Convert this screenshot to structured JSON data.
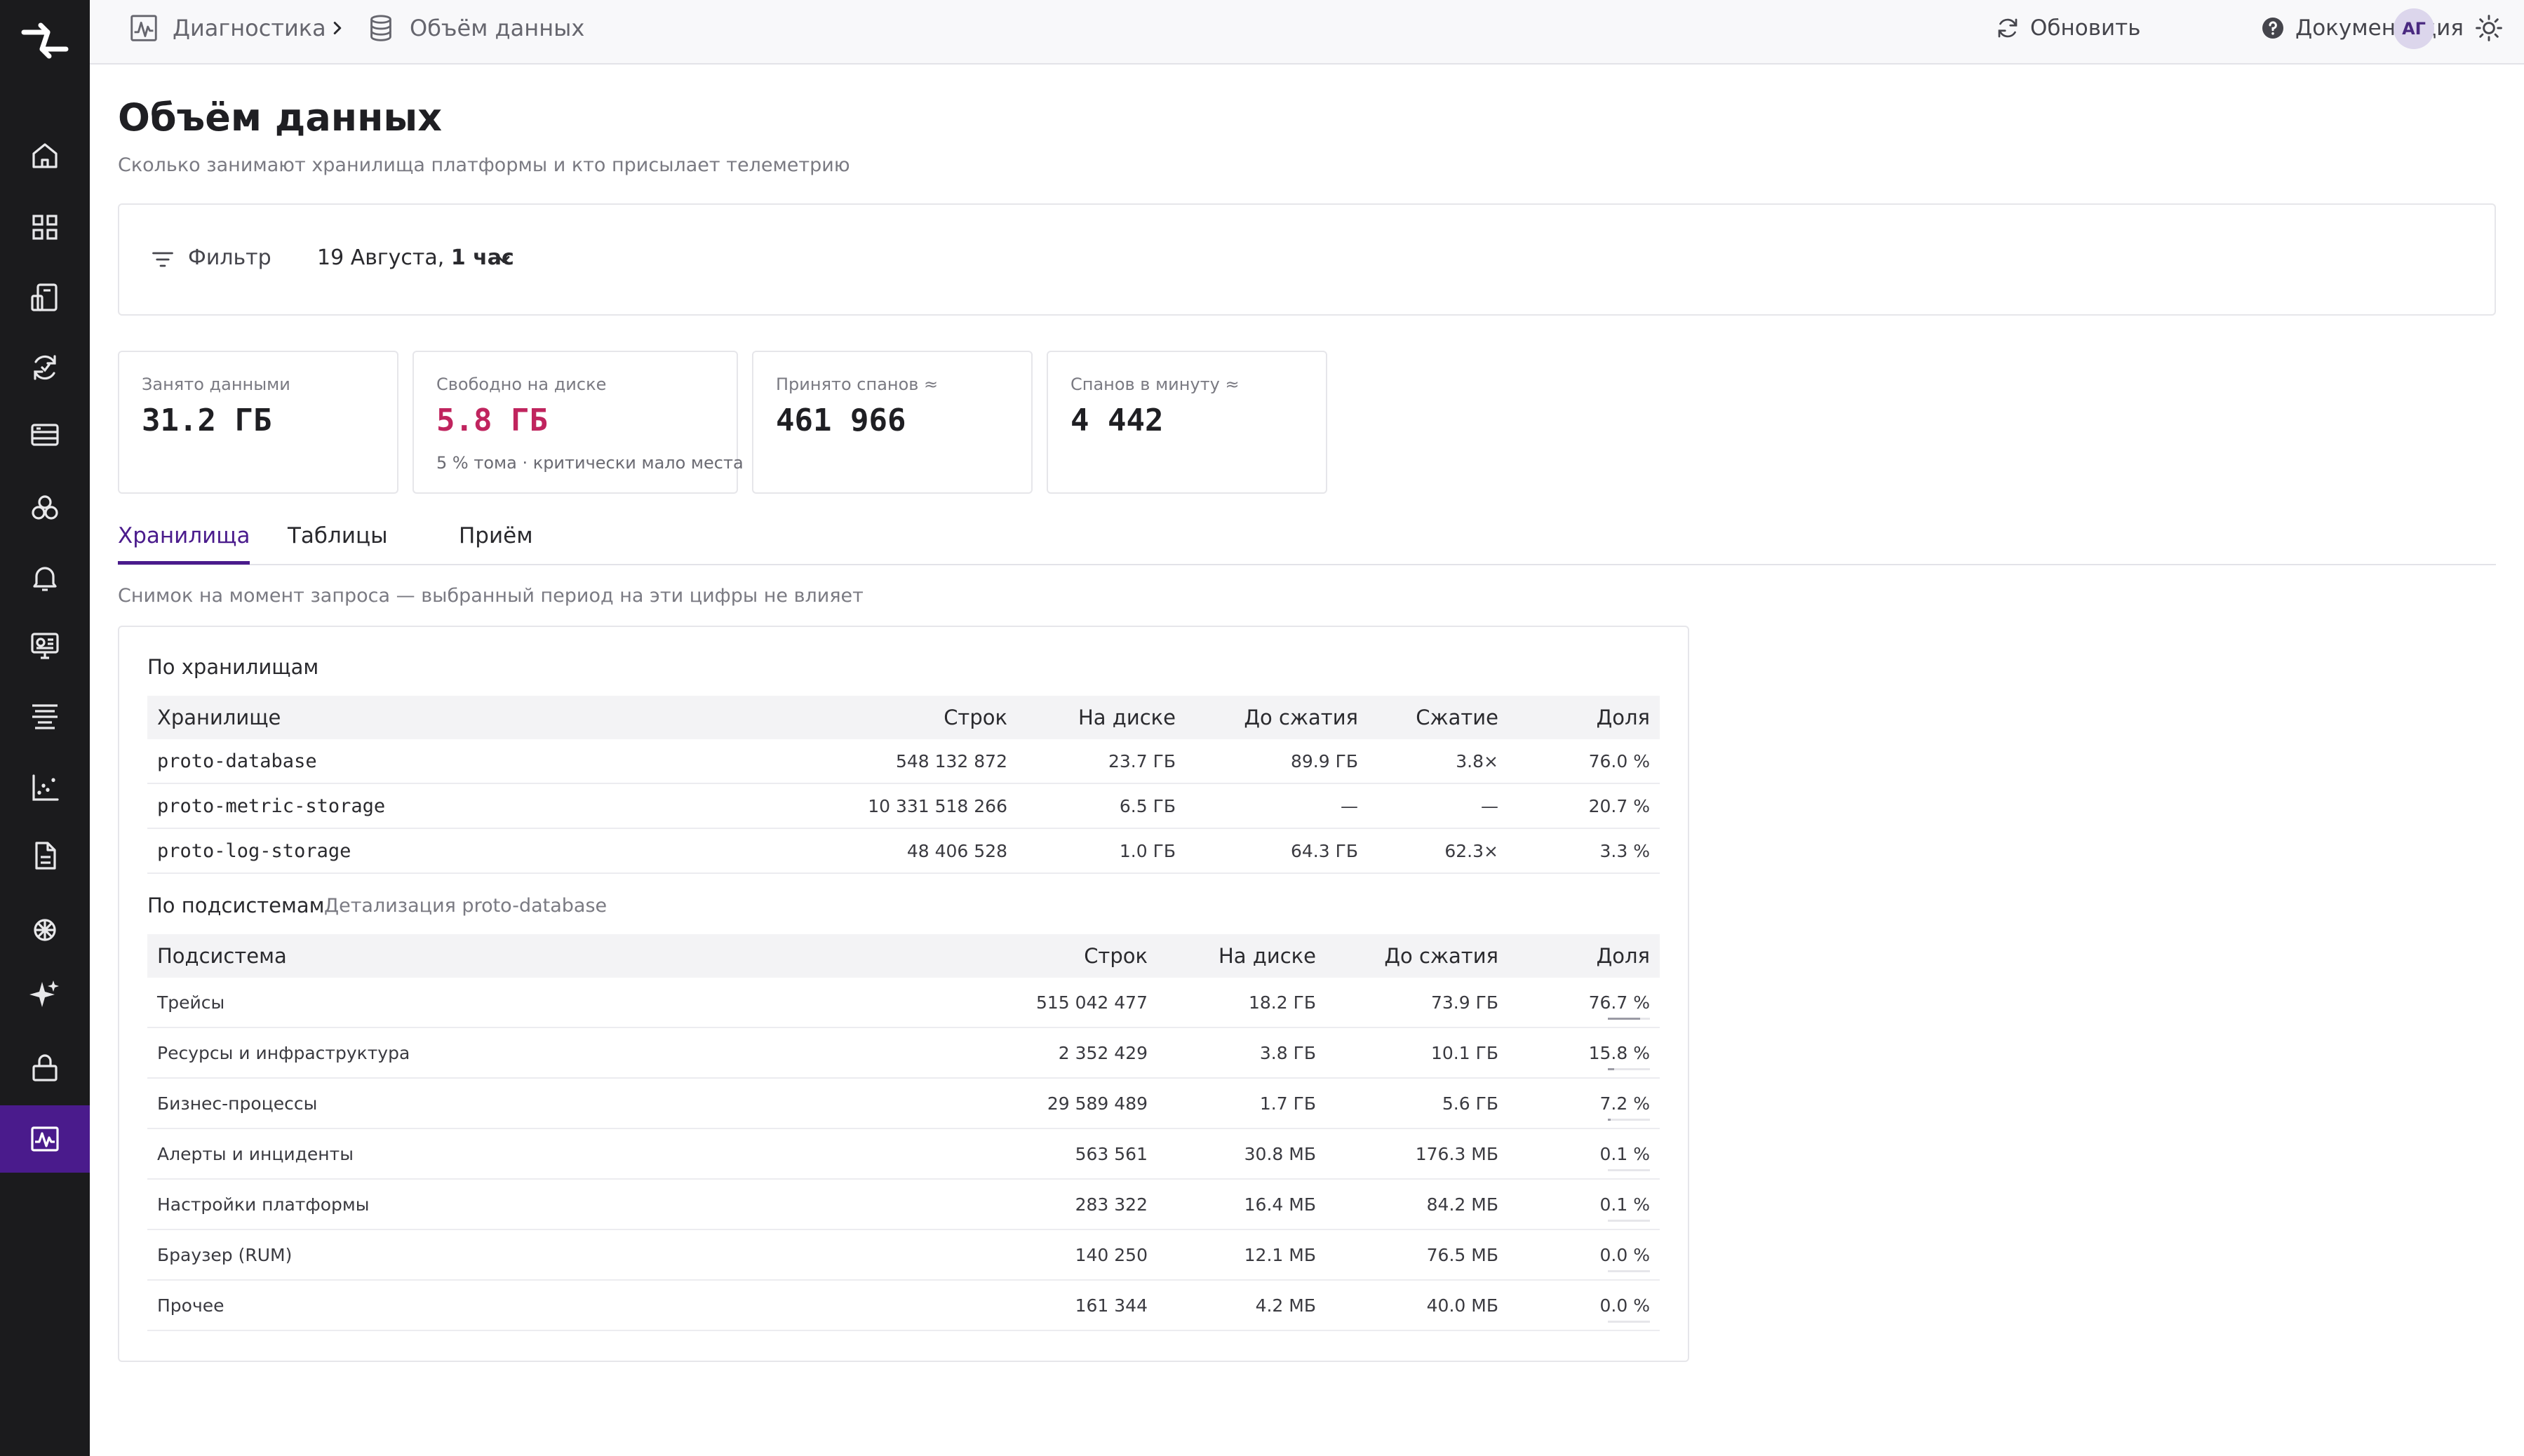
{
  "sidebar": {
    "items": [
      {
        "icon": "home-icon"
      },
      {
        "icon": "grid-icon"
      },
      {
        "icon": "device-icon"
      },
      {
        "icon": "sync-icon"
      },
      {
        "icon": "server-icon"
      },
      {
        "icon": "hexagons-icon"
      },
      {
        "icon": "bell-icon"
      },
      {
        "icon": "monitor-icon"
      },
      {
        "icon": "layers-icon"
      },
      {
        "icon": "chart-icon"
      },
      {
        "icon": "document-icon"
      },
      {
        "icon": "brain-icon"
      },
      {
        "icon": "sparkle-icon"
      },
      {
        "icon": "lock-icon"
      },
      {
        "icon": "activity-icon",
        "active": true
      }
    ]
  },
  "header": {
    "breadcrumb_parent": "Диагностика",
    "breadcrumb_current": "Объём данных",
    "refresh_label": "Обновить",
    "docs_label": "Документация",
    "avatar_initials": "АГ"
  },
  "page": {
    "title": "Объём данных",
    "subtitle": "Сколько занимают хранилища платформы и кто присылает телеметрию"
  },
  "filter": {
    "label": "Фильтр",
    "date": "19 Августа,",
    "period": "1 час"
  },
  "kpis": [
    {
      "label": "Занято данными",
      "value": "31.2 ГБ",
      "note": ""
    },
    {
      "label": "Свободно на диске",
      "value": "5.8 ГБ",
      "note": "5 % тома · критически мало места",
      "critical": true
    },
    {
      "label": "Принято спанов ≈",
      "value": "461 966",
      "note": ""
    },
    {
      "label": "Спанов в минуту ≈",
      "value": "4 442",
      "note": ""
    }
  ],
  "tabs": [
    {
      "label": "Хранилища",
      "active": true
    },
    {
      "label": "Таблицы"
    },
    {
      "label": "Приём"
    }
  ],
  "snapshot_note": "Снимок на момент запроса — выбранный период на эти цифры не влияет",
  "storages": {
    "title": "По хранилищам",
    "columns": [
      "Хранилище",
      "Строк",
      "На диске",
      "До сжатия",
      "Сжатие",
      "Доля"
    ],
    "rows": [
      [
        "proto-database",
        "548 132 872",
        "23.7 ГБ",
        "89.9 ГБ",
        "3.8×",
        "76.0 %"
      ],
      [
        "proto-metric-storage",
        "10 331 518 266",
        "6.5 ГБ",
        "—",
        "—",
        "20.7 %"
      ],
      [
        "proto-log-storage",
        "48 406 528",
        "1.0 ГБ",
        "64.3 ГБ",
        "62.3×",
        "3.3 %"
      ]
    ]
  },
  "subsystems": {
    "title": "По подсистемам",
    "hint": "Детализация proto-database",
    "columns": [
      "Подсистема",
      "Строк",
      "На диске",
      "До сжатия",
      "Доля"
    ],
    "rows": [
      {
        "name": "Трейсы",
        "rows": "515 042 477",
        "disk": "18.2 ГБ",
        "raw": "73.9 ГБ",
        "share": "76.7 %",
        "share_value": 76.7
      },
      {
        "name": "Ресурсы и инфраструктура",
        "rows": "2 352 429",
        "disk": "3.8 ГБ",
        "raw": "10.1 ГБ",
        "share": "15.8 %",
        "share_value": 15.8
      },
      {
        "name": "Бизнес-процессы",
        "rows": "29 589 489",
        "disk": "1.7 ГБ",
        "raw": "5.6 ГБ",
        "share": "7.2 %",
        "share_value": 7.2
      },
      {
        "name": "Алерты и инциденты",
        "rows": "563 561",
        "disk": "30.8 МБ",
        "raw": "176.3 МБ",
        "share": "0.1 %",
        "share_value": 0.1
      },
      {
        "name": "Настройки платформы",
        "rows": "283 322",
        "disk": "16.4 МБ",
        "raw": "84.2 МБ",
        "share": "0.1 %",
        "share_value": 0.1
      },
      {
        "name": "Браузер (RUM)",
        "rows": "140 250",
        "disk": "12.1 МБ",
        "raw": "76.5 МБ",
        "share": "0.0 %",
        "share_value": 0.0
      },
      {
        "name": "Прочее",
        "rows": "161 344",
        "disk": "4.2 МБ",
        "raw": "40.0 МБ",
        "share": "0.0 %",
        "share_value": 0.0
      }
    ]
  }
}
